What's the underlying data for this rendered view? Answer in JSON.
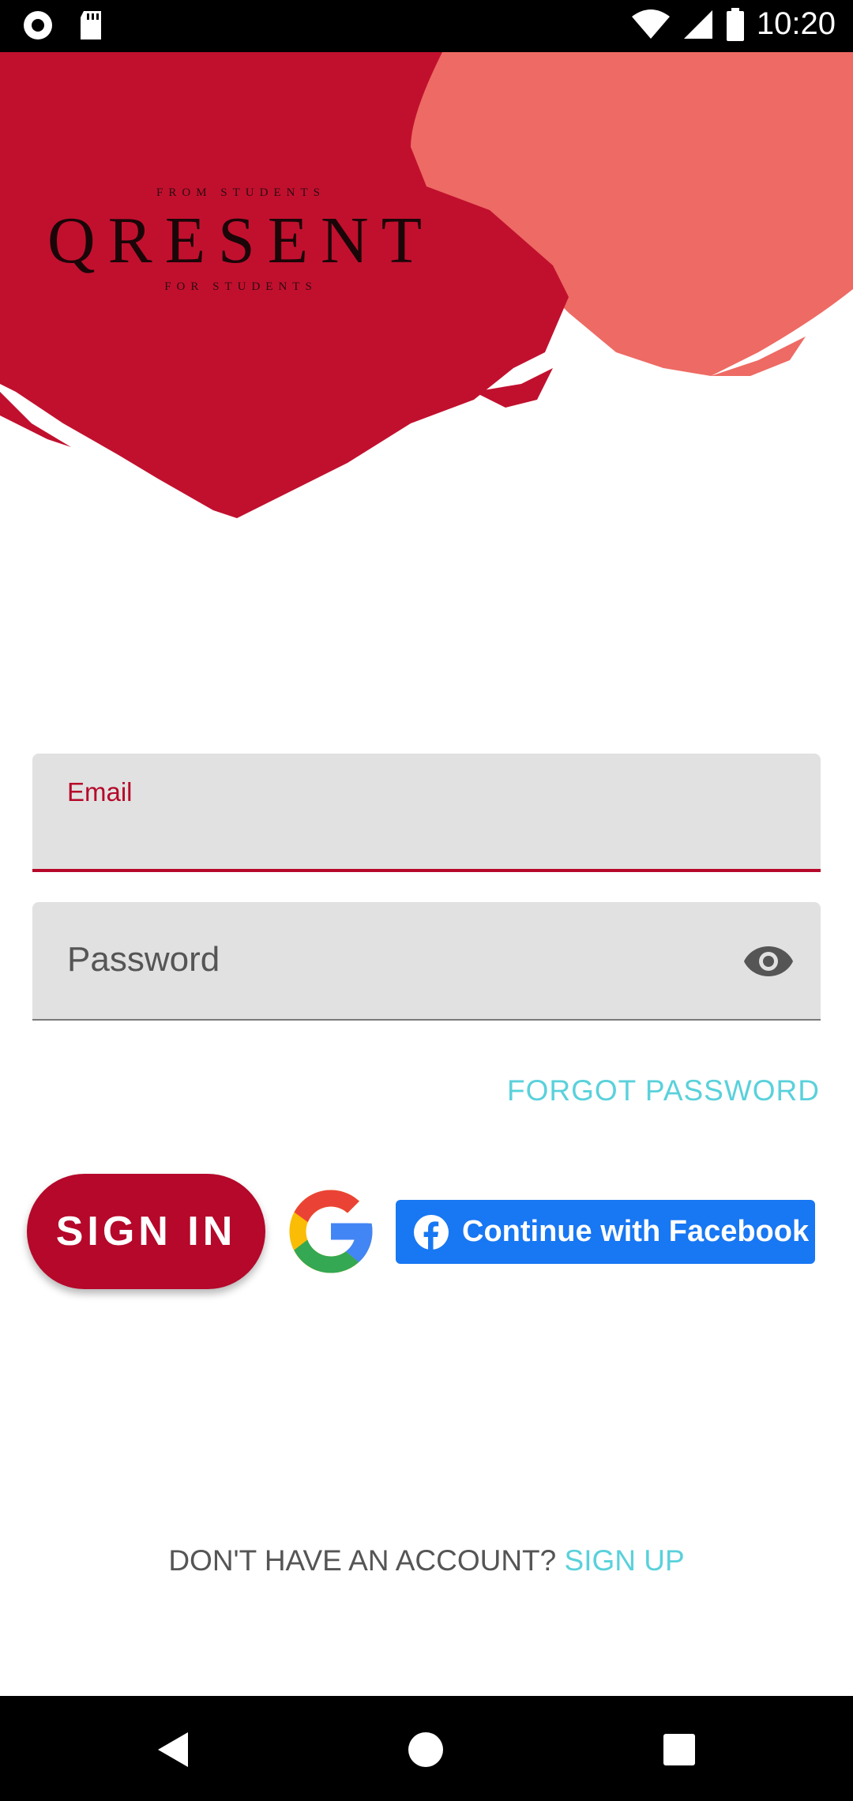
{
  "status_bar": {
    "time": "10:20",
    "left_icons": [
      "record-icon",
      "sd-card-icon"
    ],
    "right_icons": [
      "wifi-icon",
      "cell-signal-icon",
      "battery-icon"
    ]
  },
  "logo": {
    "top_line": "FROM STUDENTS",
    "main": "QRESENT",
    "bottom_line": "FOR STUDENTS"
  },
  "email_field": {
    "label": "Email",
    "value": ""
  },
  "password_field": {
    "placeholder": "Password",
    "icon": "eye-icon"
  },
  "forgot_password": "FORGOT PASSWORD",
  "sign_in_button": "SIGN IN",
  "google_button": {
    "icon": "google-g-icon"
  },
  "facebook_button": {
    "label": "Continue with Facebook",
    "icon": "facebook-icon"
  },
  "signup_prompt": {
    "question": "DON'T HAVE AN ACCOUNT?",
    "link": "SIGN UP"
  },
  "nav_bar": {
    "buttons": [
      "back-icon",
      "home-icon",
      "recents-icon"
    ]
  },
  "colors": {
    "accent": "#b5082a",
    "link": "#5ad1db",
    "paint_red": "#c1102e",
    "paint_coral": "#ee6a64",
    "facebook": "#1877f2"
  }
}
